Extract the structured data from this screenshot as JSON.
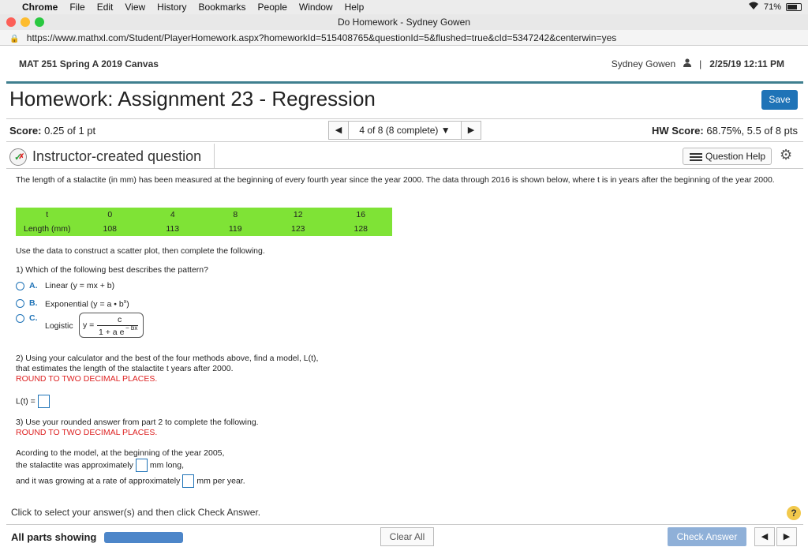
{
  "os_menu": {
    "app": "Chrome",
    "items": [
      "File",
      "Edit",
      "View",
      "History",
      "Bookmarks",
      "People",
      "Window",
      "Help"
    ],
    "battery": "71%"
  },
  "window": {
    "title": "Do Homework - Sydney Gowen"
  },
  "browser": {
    "url": "https://www.mathxl.com/Student/PlayerHomework.aspx?homeworkId=515408765&questionId=5&flushed=true&cId=5347242&centerwin=yes"
  },
  "course": {
    "name": "MAT 251 Spring A 2019 Canvas",
    "user": "Sydney Gowen",
    "separator": "|",
    "datetime": "2/25/19 12:11 PM"
  },
  "homework": {
    "title": "Homework: Assignment 23 - Regression",
    "save_label": "Save"
  },
  "scorebar": {
    "score_label": "Score:",
    "score_value": "0.25 of 1 pt",
    "pager_text": "4 of 8 (8 complete) ▼",
    "hw_label": "HW Score:",
    "hw_value": "68.75%, 5.5 of 8 pts"
  },
  "question": {
    "header": "Instructor-created question",
    "help_label": "Question Help",
    "intro": "The length of a stalactite (in mm) has been measured at the beginning of every fourth year since the year 2000.  The data through 2016 is shown below, where t is in years after the beginning of the year 2000.",
    "table": {
      "row1": [
        "t",
        "0",
        "4",
        "8",
        "12",
        "16"
      ],
      "row2": [
        "Length (mm)",
        "108",
        "113",
        "119",
        "123",
        "128"
      ]
    },
    "instruction": "Use the data to construct a scatter plot, then complete the following.",
    "q1": "1) Which of the following best describes the pattern?",
    "options": [
      {
        "letter": "A.",
        "text": "Linear (y = mx + b)"
      },
      {
        "letter": "B.",
        "text": "Exponential (y = a • b",
        "sup": "x",
        "tail": ")"
      },
      {
        "letter": "C.",
        "text": "Logistic"
      }
    ],
    "logistic": {
      "y": "y =",
      "numerator": "c",
      "denominator": "1 + a e",
      "exponent": "− bx"
    },
    "q2_line1": "2) Using your calculator and the best of the four methods above, find a model, L(t),",
    "q2_line2": "that estimates the length of the stalactite t years after 2000.",
    "round_note": "ROUND TO TWO DECIMAL PLACES.",
    "lt_label": "L(t) =",
    "q3": "3) Use your rounded answer from part 2 to complete the following.",
    "q3_line1": "Acording to the model, at the beginning of the year 2005,",
    "q3_line2a": "the stalactite was approximately",
    "q3_line2b": "mm long,",
    "q3_line3a": "and it was growing at a rate of approximately",
    "q3_line3b": "mm per year."
  },
  "footer": {
    "hint": "Click to select your answer(s) and then click Check Answer.",
    "help": "?",
    "all_parts": "All parts showing",
    "clear_all": "Clear All",
    "check_answer": "Check Answer"
  }
}
